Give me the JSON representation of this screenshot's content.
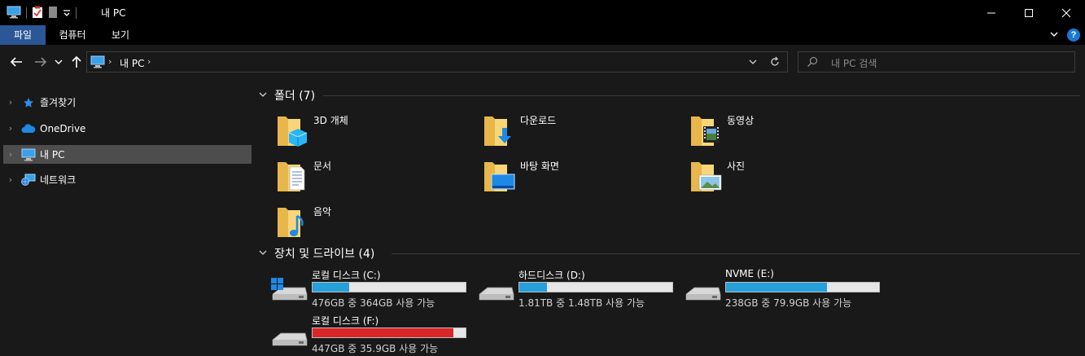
{
  "window": {
    "title": "내 PC"
  },
  "ribbon": {
    "tabs": [
      {
        "label": "파일",
        "active": true
      },
      {
        "label": "컴퓨터",
        "active": false
      },
      {
        "label": "보기",
        "active": false
      }
    ],
    "help": "?"
  },
  "address": {
    "path": "내 PC",
    "search_placeholder": "내 PC 검색"
  },
  "sidebar": {
    "items": [
      {
        "label": "즐겨찾기",
        "icon": "star-icon",
        "selected": false
      },
      {
        "label": "OneDrive",
        "icon": "cloud-icon",
        "selected": false
      },
      {
        "label": "내 PC",
        "icon": "computer-icon",
        "selected": true
      },
      {
        "label": "네트워크",
        "icon": "network-icon",
        "selected": false
      }
    ]
  },
  "folders": {
    "title": "폴더 (7)",
    "items": [
      {
        "label": "3D 개체",
        "icon": "folder-3d-objects-icon"
      },
      {
        "label": "다운로드",
        "icon": "folder-downloads-icon"
      },
      {
        "label": "동영상",
        "icon": "folder-videos-icon"
      },
      {
        "label": "문서",
        "icon": "folder-documents-icon"
      },
      {
        "label": "바탕 화면",
        "icon": "folder-desktop-icon"
      },
      {
        "label": "사진",
        "icon": "folder-pictures-icon"
      },
      {
        "label": "음악",
        "icon": "folder-music-icon"
      }
    ]
  },
  "drives": {
    "title": "장치 및 드라이브 (4)",
    "items": [
      {
        "name": "로컬 디스크 (C:)",
        "info": "476GB 중 364GB 사용 가능",
        "used_fraction": 0.24,
        "bar_color": "#26a0da",
        "icon": "windows-drive-icon"
      },
      {
        "name": "하드디스크 (D:)",
        "info": "1.81TB 중 1.48TB 사용 가능",
        "used_fraction": 0.18,
        "bar_color": "#26a0da",
        "icon": "hard-drive-icon"
      },
      {
        "name": "NVME (E:)",
        "info": "238GB 중 79.9GB 사용 가능",
        "used_fraction": 0.66,
        "bar_color": "#26a0da",
        "icon": "hard-drive-icon"
      },
      {
        "name": "로컬 디스크 (F:)",
        "info": "447GB 중 35.9GB 사용 가능",
        "used_fraction": 0.92,
        "bar_color": "#da2626",
        "icon": "hard-drive-icon"
      }
    ]
  },
  "colors": {
    "accent": "#2b5797",
    "bar_normal": "#26a0da",
    "bar_warning": "#da2626"
  }
}
